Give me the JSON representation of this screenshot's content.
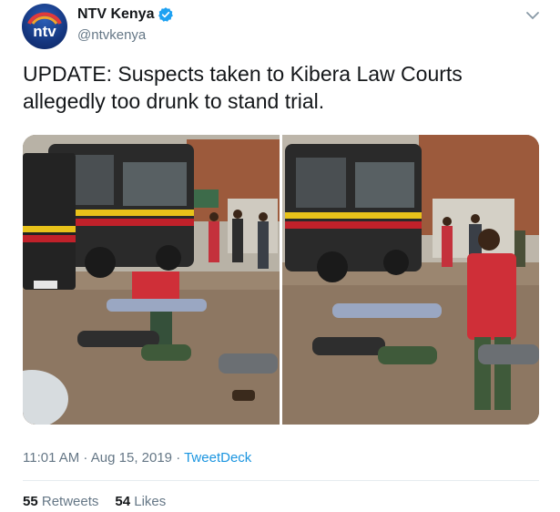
{
  "tweet": {
    "display_name": "NTV Kenya",
    "handle": "@ntvkenya",
    "avatar_text": "ntv",
    "verified": true,
    "text": "UPDATE: Suspects taken to Kibera Law Courts allegedly too drunk to stand trial.",
    "time": "11:01 AM",
    "date": "Aug 15, 2019",
    "source": "TweetDeck",
    "retweets_count": "55",
    "retweets_label": "Retweets",
    "likes_count": "54",
    "likes_label": "Likes",
    "separator": " · "
  },
  "media": {
    "photo_count": 2,
    "left_photo_plate": "KCB 003L",
    "description_icons": [
      "bus",
      "people"
    ]
  },
  "colors": {
    "link": "#1b95e0",
    "secondary_text": "#657786",
    "verified": "#1da1f2"
  }
}
